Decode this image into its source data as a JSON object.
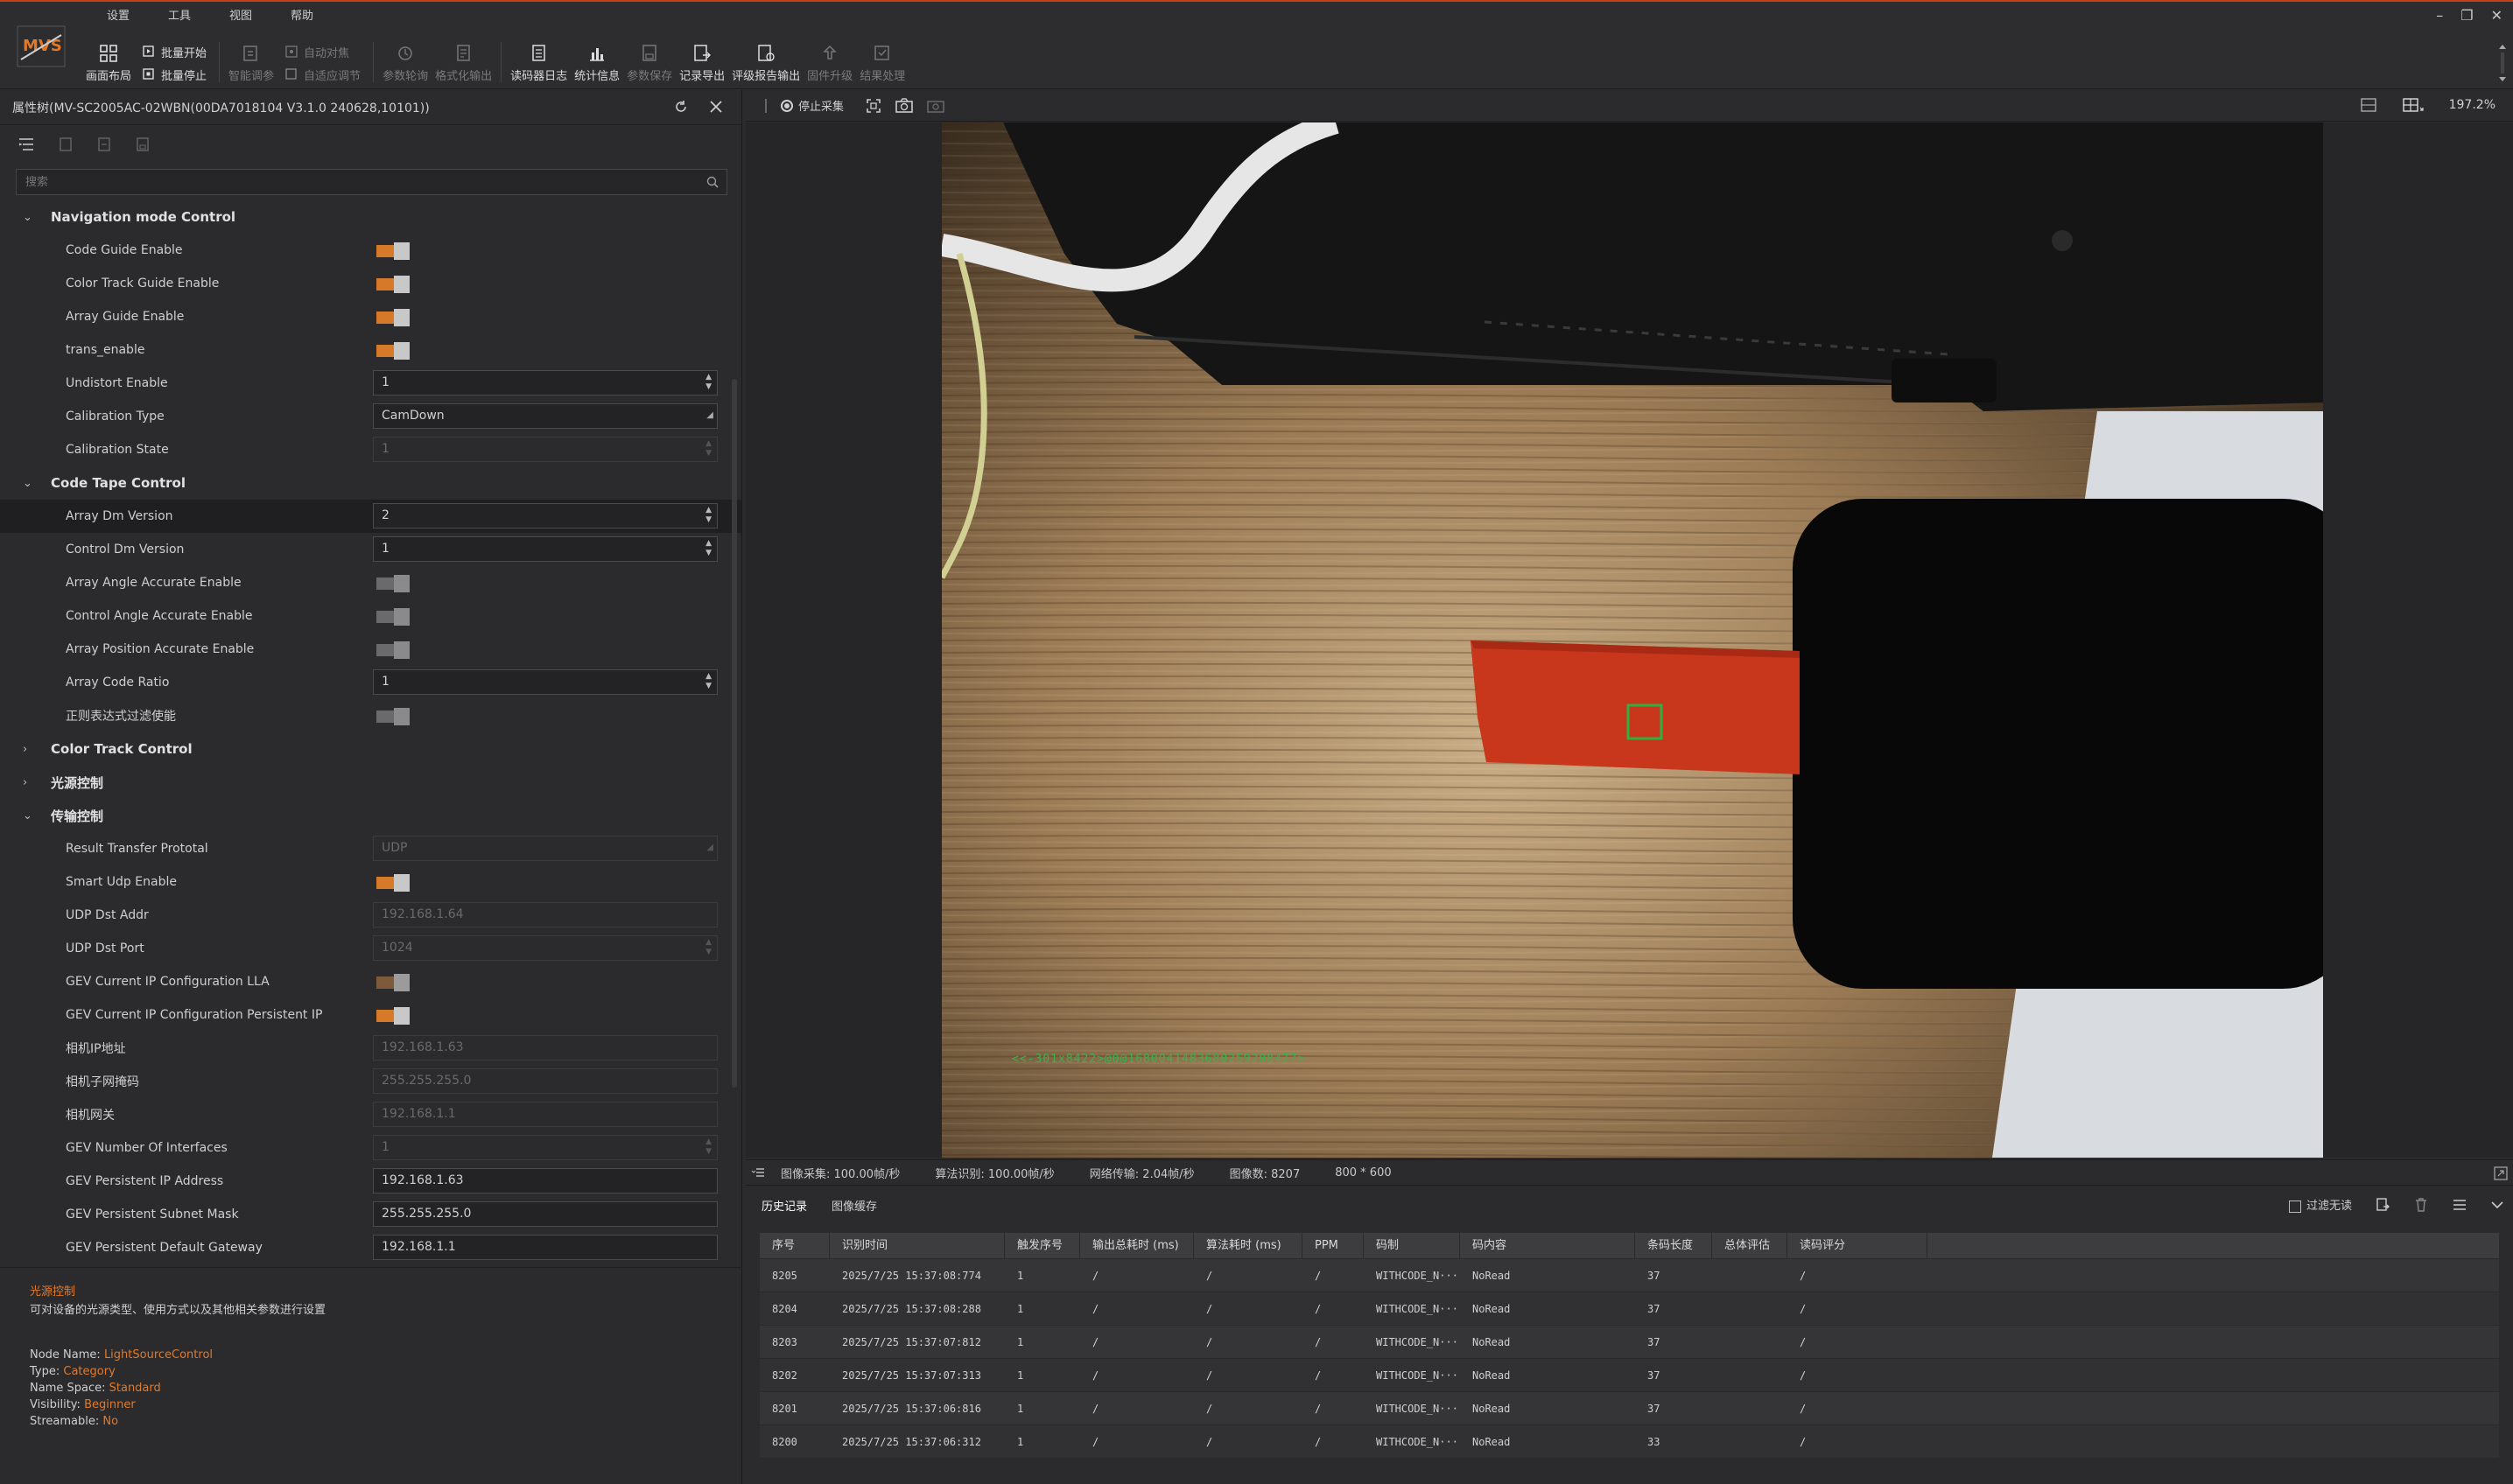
{
  "menu": [
    "设置",
    "工具",
    "视图",
    "帮助"
  ],
  "toolbar": {
    "layout": "画面布局",
    "batch_start": "批量开始",
    "batch_stop": "批量停止",
    "smart_tune": "智能调参",
    "auto_focus": "自动对焦",
    "adaptive_adjust": "自适应调节",
    "param_poll": "参数轮询",
    "format_output": "格式化输出",
    "reader_log": "读码器日志",
    "stats": "统计信息",
    "param_save": "参数保存",
    "record_export": "记录导出",
    "grade_report": "评级报告输出",
    "firmware": "固件升级",
    "result_process": "结果处理"
  },
  "property_panel": {
    "title": "属性树(MV-SC2005AC-02WBN(00DA7018104 V3.1.0 240628,10101))",
    "search_placeholder": "搜索",
    "categories": {
      "nav": "Navigation mode Control",
      "code_tape": "Code Tape Control",
      "color_track": "Color Track Control",
      "light_source": "光源控制",
      "transfer": "传输控制"
    },
    "nav_props": {
      "code_guide": "Code Guide Enable",
      "color_track_guide": "Color Track Guide Enable",
      "array_guide": "Array Guide Enable",
      "trans_enable": "trans_enable",
      "undistort": "Undistort Enable",
      "undistort_value": "1",
      "calib_type": "Calibration Type",
      "calib_type_value": "CamDown",
      "calib_state": "Calibration State",
      "calib_state_value": "1"
    },
    "code_tape_props": {
      "array_dm": "Array Dm Version",
      "array_dm_value": "2",
      "control_dm": "Control Dm Version",
      "control_dm_value": "1",
      "array_angle": "Array Angle Accurate Enable",
      "control_angle": "Control Angle Accurate Enable",
      "array_position": "Array Position Accurate Enable",
      "array_ratio": "Array Code Ratio",
      "array_ratio_value": "1",
      "regex_filter": "正则表达式过滤使能"
    },
    "transfer_props": {
      "result_protocol": "Result Transfer Prototal",
      "result_protocol_value": "UDP",
      "smart_udp": "Smart Udp Enable",
      "udp_addr": "UDP Dst Addr",
      "udp_addr_value": "192.168.1.64",
      "udp_port": "UDP Dst Port",
      "udp_port_value": "1024",
      "gev_lla": "GEV Current IP Configuration LLA",
      "gev_persistent": "GEV Current IP Configuration Persistent IP",
      "cam_ip": "相机IP地址",
      "cam_ip_value": "192.168.1.63",
      "cam_mask": "相机子网掩码",
      "cam_mask_value": "255.255.255.0",
      "cam_gw": "相机网关",
      "cam_gw_value": "192.168.1.1",
      "gev_num_if": "GEV Number Of Interfaces",
      "gev_num_if_value": "1",
      "gev_p_ip": "GEV Persistent IP Address",
      "gev_p_ip_value": "192.168.1.63",
      "gev_p_mask": "GEV Persistent Subnet Mask",
      "gev_p_mask_value": "255.255.255.0",
      "gev_p_gw": "GEV Persistent Default Gateway",
      "gev_p_gw_value": "192.168.1.1"
    },
    "description": {
      "title": "光源控制",
      "text": "可对设备的光源类型、使用方式以及其他相关参数进行设置",
      "node_name_label": "Node Name:",
      "node_name": "LightSourceControl",
      "type_label": "Type:",
      "type": "Category",
      "namespace_label": "Name Space:",
      "namespace": "Standard",
      "visibility_label": "Visibility:",
      "visibility": "Beginner",
      "streamable_label": "Streamable:",
      "streamable": "No"
    }
  },
  "viewer": {
    "stop_label": "停止采集",
    "zoom": "197.2%",
    "ocr_overlay": "<<-301x8422>@0@16800414836802592084Z7>"
  },
  "status": {
    "capture": "图像采集: 100.00帧/秒",
    "algo": "算法识别: 100.00帧/秒",
    "net": "网络传输: 2.04帧/秒",
    "count": "图像数: 8207",
    "resolution": "800 * 600"
  },
  "history": {
    "tabs": [
      "历史记录",
      "图像缓存"
    ],
    "filter_label": "过滤无读",
    "columns": [
      "序号",
      "识别时间",
      "触发序号",
      "输出总耗时 (ms)",
      "算法耗时 (ms)",
      "PPM",
      "码制",
      "码内容",
      "条码长度",
      "总体评估",
      "读码评分"
    ],
    "rows": [
      [
        "8205",
        "2025/7/25 15:37:08:774",
        "1",
        "/",
        "/",
        "/",
        "WITHCODE_N···",
        "NoRead",
        "37",
        "",
        "/"
      ],
      [
        "8204",
        "2025/7/25 15:37:08:288",
        "1",
        "/",
        "/",
        "/",
        "WITHCODE_N···",
        "NoRead",
        "37",
        "",
        "/"
      ],
      [
        "8203",
        "2025/7/25 15:37:07:812",
        "1",
        "/",
        "/",
        "/",
        "WITHCODE_N···",
        "NoRead",
        "37",
        "",
        "/"
      ],
      [
        "8202",
        "2025/7/25 15:37:07:313",
        "1",
        "/",
        "/",
        "/",
        "WITHCODE_N···",
        "NoRead",
        "37",
        "",
        "/"
      ],
      [
        "8201",
        "2025/7/25 15:37:06:816",
        "1",
        "/",
        "/",
        "/",
        "WITHCODE_N···",
        "NoRead",
        "37",
        "",
        "/"
      ],
      [
        "8200",
        "2025/7/25 15:37:06:312",
        "1",
        "/",
        "/",
        "/",
        "WITHCODE_N···",
        "NoRead",
        "33",
        "",
        "/"
      ]
    ]
  },
  "colors": {
    "accent": "#d67a2a",
    "title_line": "#c8401a",
    "detection_box": "#2fb041"
  }
}
